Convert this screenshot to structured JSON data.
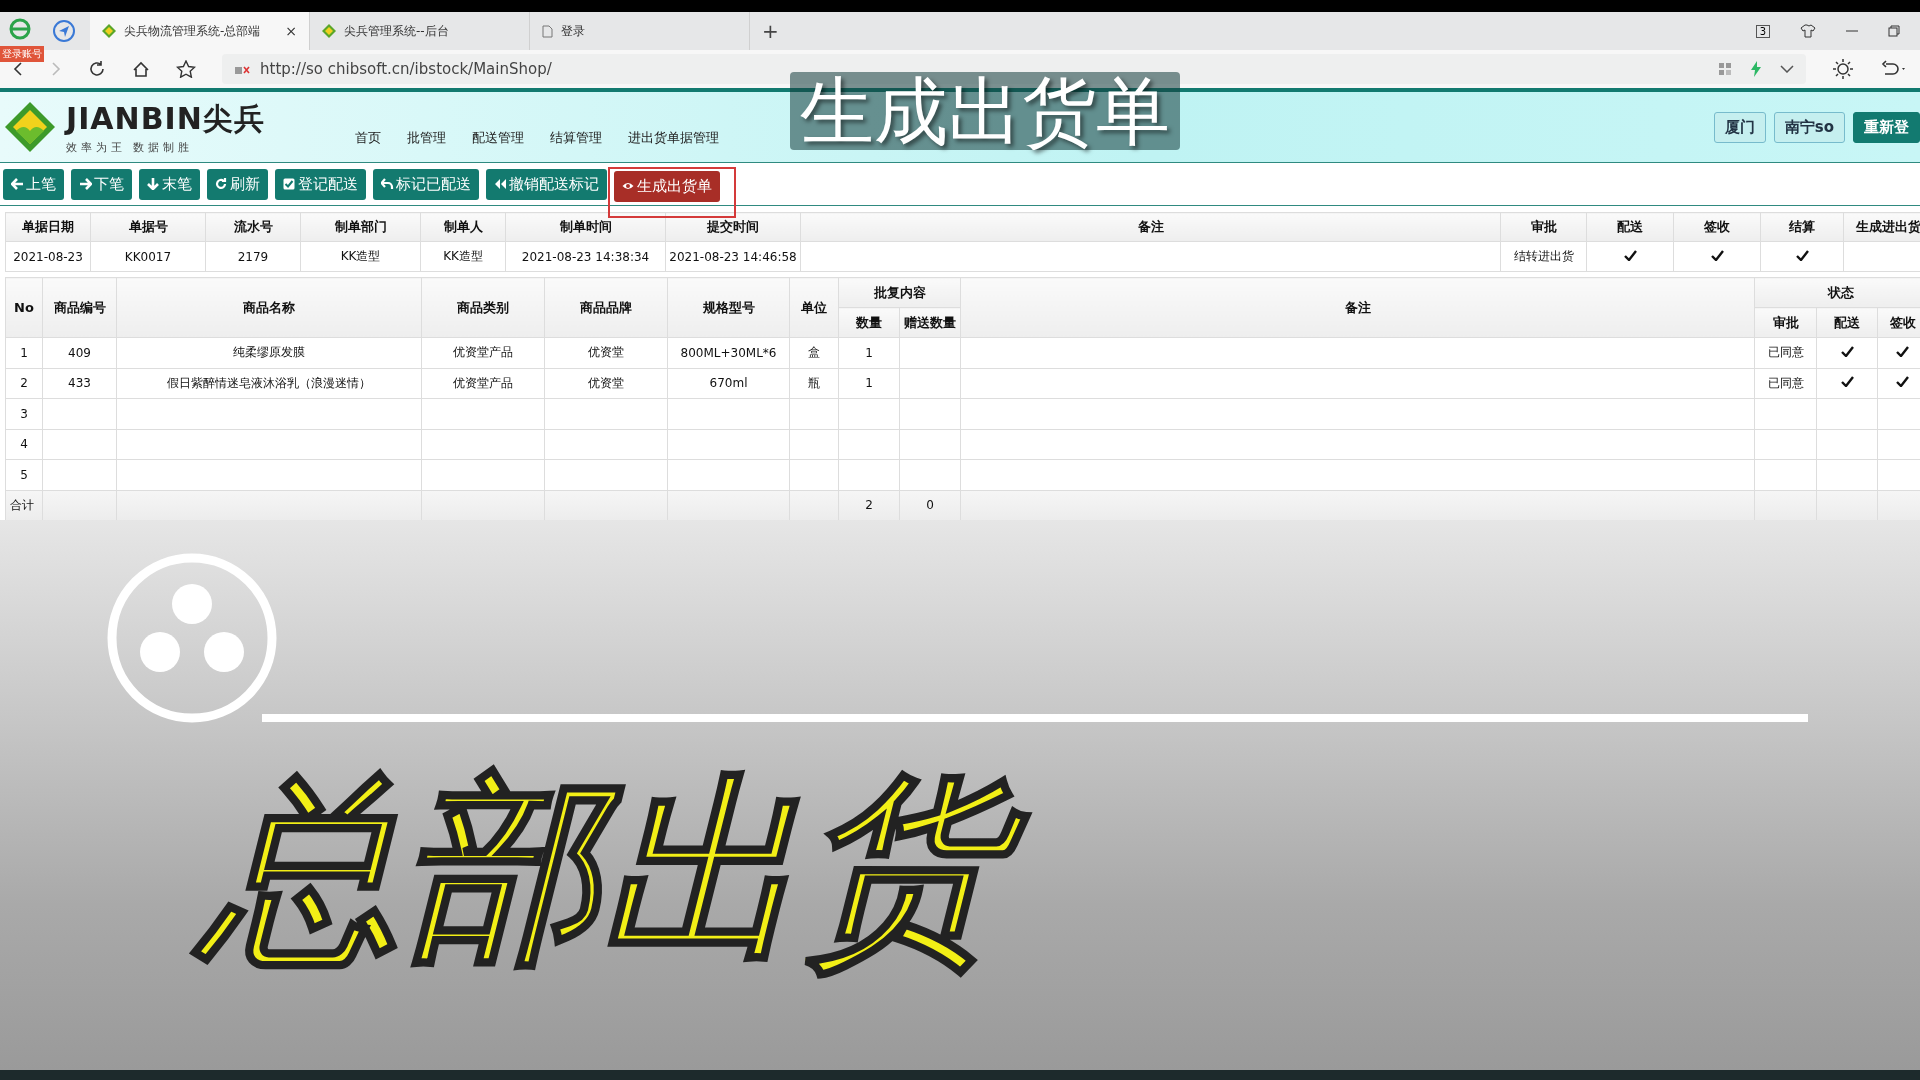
{
  "browser": {
    "tabs": [
      {
        "title": "尖兵物流管理系统-总部端",
        "selected": true
      },
      {
        "title": "尖兵管理系统--后台",
        "selected": false
      },
      {
        "title": "登录",
        "selected": false
      }
    ],
    "close_tab": "×",
    "new_tab": "+",
    "tab_count": "3",
    "badge": "登录账号",
    "address": "http://so chibsoft.cn/ibstock/MainShop/"
  },
  "app": {
    "logo_text": "JIANBIN尖兵",
    "slogan": "效率为王 数据制胜",
    "nav": [
      "首页",
      "批管理",
      "配送管理",
      "结算管理",
      "进出货单据管理"
    ],
    "user_buttons": [
      {
        "label": "厦门",
        "kind": "light"
      },
      {
        "label": "南宁so",
        "kind": "light"
      },
      {
        "label": "重新登",
        "kind": "dark"
      }
    ]
  },
  "toolbar": [
    {
      "label": "上笔",
      "kind": "normal",
      "highlighted": false
    },
    {
      "label": "下笔",
      "kind": "normal",
      "highlighted": false
    },
    {
      "label": "末笔",
      "kind": "normal",
      "highlighted": false
    },
    {
      "label": "刷新",
      "kind": "normal",
      "highlighted": false
    },
    {
      "label": "登记配送",
      "kind": "normal",
      "highlighted": false
    },
    {
      "label": "标记已配送",
      "kind": "normal",
      "highlighted": false
    },
    {
      "label": "撤销配送标记",
      "kind": "normal",
      "highlighted": false
    },
    {
      "label": "生成出货单",
      "kind": "danger",
      "highlighted": true
    }
  ],
  "order": {
    "columns": [
      "单据日期",
      "单据号",
      "流水号",
      "制单部门",
      "制单人",
      "制单时间",
      "提交时间",
      "备注",
      "审批",
      "配送",
      "签收",
      "结算",
      "生成进出货"
    ],
    "row": {
      "date": "2021-08-23",
      "number": "KK0017",
      "serial": "2179",
      "department": "KK造型",
      "creator": "KK造型",
      "created": "2021-08-23 14:38:34",
      "submitted": "2021-08-23 14:46:58",
      "approval": "结转进出货",
      "delivered": true,
      "signed": true,
      "settled": true
    }
  },
  "items": {
    "columns": [
      "No",
      "商品编号",
      "商品名称",
      "商品类别",
      "商品品牌",
      "规格型号",
      "单位",
      "批复内容",
      "数量",
      "赠送数量",
      "备注",
      "状态",
      "审批",
      "配送",
      "签收"
    ],
    "rows": [
      {
        "no": "1",
        "code": "409",
        "name": "纯柔缪原发膜",
        "category": "优资堂产品",
        "brand": "优资堂",
        "spec": "800ML+30ML*6",
        "unit": "盒",
        "qty": "1",
        "approval": "已同意",
        "delivered": true,
        "signed": true
      },
      {
        "no": "2",
        "code": "433",
        "name": "假日紫醉情迷皂液沐浴乳（浪漫迷情）",
        "category": "优资堂产品",
        "brand": "优资堂",
        "spec": "670ml",
        "unit": "瓶",
        "qty": "1",
        "approval": "已同意",
        "delivered": true,
        "signed": true
      },
      {
        "no": "3"
      },
      {
        "no": "4"
      },
      {
        "no": "5"
      }
    ],
    "total": {
      "label": "合计",
      "qty": "2",
      "gift": "0"
    }
  },
  "captions": {
    "top": "生成出货单",
    "main": "总部出货"
  }
}
